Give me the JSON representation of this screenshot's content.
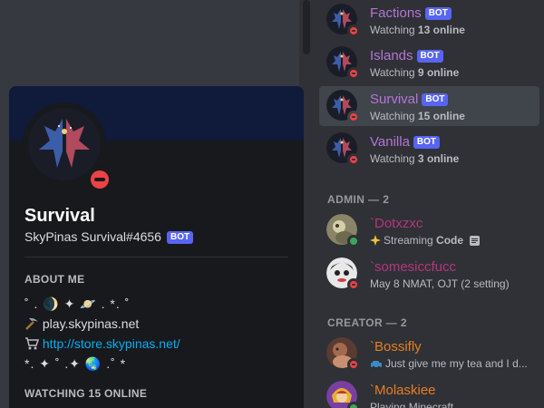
{
  "colors": {
    "bot_tag": "#5865f2",
    "dnd": "#ed4245",
    "online": "#3ba55d",
    "bot_name": "#b674d6",
    "admin_name": "#b5357e",
    "creator_name": "#e67e22",
    "link": "#00aff4"
  },
  "bot_tag_label": "BOT",
  "members": {
    "bots": [
      {
        "name": "Factions",
        "status_prefix": "Watching ",
        "count": "13",
        "status_suffix": " online"
      },
      {
        "name": "Islands",
        "status_prefix": "Watching ",
        "count": "9",
        "status_suffix": " online"
      },
      {
        "name": "Survival",
        "status_prefix": "Watching ",
        "count": "15",
        "status_suffix": " online"
      },
      {
        "name": "Vanilla",
        "status_prefix": "Watching ",
        "count": "3",
        "status_suffix": " online"
      }
    ],
    "admin_header": "ADMIN — 2",
    "admins": [
      {
        "name": "`Dotxzxc",
        "status_prefix": "Streaming ",
        "status_bold": "Code",
        "icon": "sparkles-icon"
      },
      {
        "name": "`somesiccfucc",
        "status": "May 8 NMAT, OJT (2 setting)"
      }
    ],
    "creator_header": "CREATOR — 2",
    "creators": [
      {
        "name": "`Bossifly",
        "status": "Just give me my tea and I d...",
        "icon": "car-icon"
      },
      {
        "name": "`Molaskiee",
        "status": "Playing Minecraft"
      }
    ]
  },
  "profile": {
    "username": "Survival",
    "tag": "SkyPinas Survival#4656",
    "about_header": "ABOUT ME",
    "about_lines": [
      "˚  .  🌒  ✦  🪐  .  *.  ˚",
      "play.skypinas.net",
      "http://store.skypinas.net/",
      "*.  ✦  ˚  .✦  🌏  .˚  *"
    ],
    "watching_header": "WATCHING 15 ONLINE"
  }
}
